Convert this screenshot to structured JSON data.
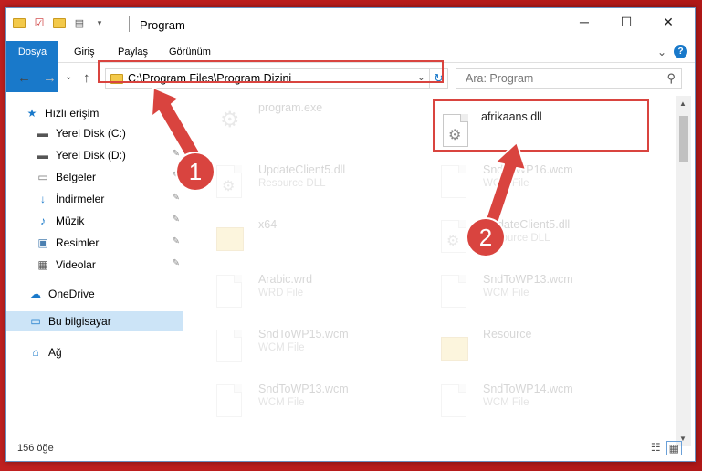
{
  "window": {
    "title": "Program",
    "minimize": "─",
    "maximize": "☐",
    "close": "✕"
  },
  "ribbon": {
    "tabs": [
      "Dosya",
      "Giriş",
      "Paylaş",
      "Görünüm"
    ],
    "expand": "⌄",
    "help": "?"
  },
  "nav": {
    "back": "←",
    "forward": "→",
    "recent": "⌄",
    "up": "↑",
    "address": "C:\\Program Files\\Program Dizini",
    "search_placeholder": "Ara: Program"
  },
  "sidebar": {
    "items": [
      {
        "label": "Hızlı erişim",
        "icon": "star-icon"
      },
      {
        "label": "Yerel Disk (C:)",
        "icon": "drive-icon"
      },
      {
        "label": "Yerel Disk (D:)",
        "icon": "drive-icon"
      },
      {
        "label": "Belgeler",
        "icon": "documents-icon"
      },
      {
        "label": "İndirmeler",
        "icon": "download-icon"
      },
      {
        "label": "Müzik",
        "icon": "music-icon"
      },
      {
        "label": "Resimler",
        "icon": "pictures-icon"
      },
      {
        "label": "Videolar",
        "icon": "video-icon"
      },
      {
        "label": "OneDrive",
        "icon": "cloud-icon"
      },
      {
        "label": "Bu bilgisayar",
        "icon": "computer-icon"
      },
      {
        "label": "Ağ",
        "icon": "network-icon"
      }
    ]
  },
  "files": [
    {
      "name": "program.exe",
      "type": ""
    },
    {
      "name": "afrikaans.dll",
      "type": ""
    },
    {
      "name": "UpdateClient5.dll",
      "type": "Resource DLL"
    },
    {
      "name": "SndToWP16.wcm",
      "type": "WCM File"
    },
    {
      "name": "x64",
      "type": ""
    },
    {
      "name": "UpdateClient5.dll",
      "type": "Resource DLL"
    },
    {
      "name": "Arabic.wrd",
      "type": "WRD File"
    },
    {
      "name": "SndToWP13.wcm",
      "type": "WCM File"
    },
    {
      "name": "SndToWP15.wcm",
      "type": "WCM File"
    },
    {
      "name": "Resource",
      "type": ""
    },
    {
      "name": "SndToWP13.wcm",
      "type": "WCM File"
    },
    {
      "name": "SndToWP14.wcm",
      "type": "WCM File"
    }
  ],
  "status": {
    "count": "156 öğe"
  },
  "annotations": {
    "step1": "1",
    "step2": "2",
    "highlight_color": "#d9443f"
  }
}
